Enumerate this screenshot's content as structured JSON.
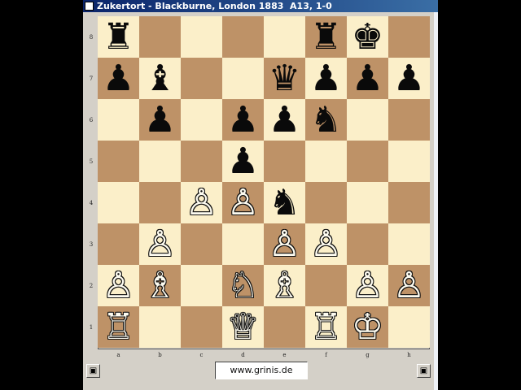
{
  "window": {
    "title": "Zukertort - Blackburne, London 1883  A13, 1-0"
  },
  "board": {
    "ranks": [
      "8",
      "7",
      "6",
      "5",
      "4",
      "3",
      "2",
      "1"
    ],
    "files": [
      "a",
      "b",
      "c",
      "d",
      "e",
      "f",
      "g",
      "h"
    ],
    "colors": {
      "light": "#fbefc9",
      "dark": "#be9267"
    },
    "pieces": {
      "a8": "♜",
      "f8": "♜",
      "g8": "♚",
      "a7": "♟",
      "b7": "♝",
      "e7": "♛",
      "f7": "♟",
      "g7": "♟",
      "h7": "♟",
      "b6": "♟",
      "d6": "♟",
      "e6": "♟",
      "f6": "♞",
      "d5": "♟",
      "c4": "♙",
      "d4": "♙",
      "e4": "♞",
      "b3": "♙",
      "e3": "♙",
      "f3": "♙",
      "a2": "♙",
      "b2": "♗",
      "d2": "♘",
      "e2": "♗",
      "g2": "♙",
      "h2": "♙",
      "a1": "♖",
      "d1": "♕",
      "f1": "♖",
      "g1": "♔"
    }
  },
  "footer": {
    "website": "www.grinis.de",
    "left_button_icon": "board-flip-icon",
    "right_button_icon": "board-flip-icon",
    "button_glyph": "▣"
  }
}
